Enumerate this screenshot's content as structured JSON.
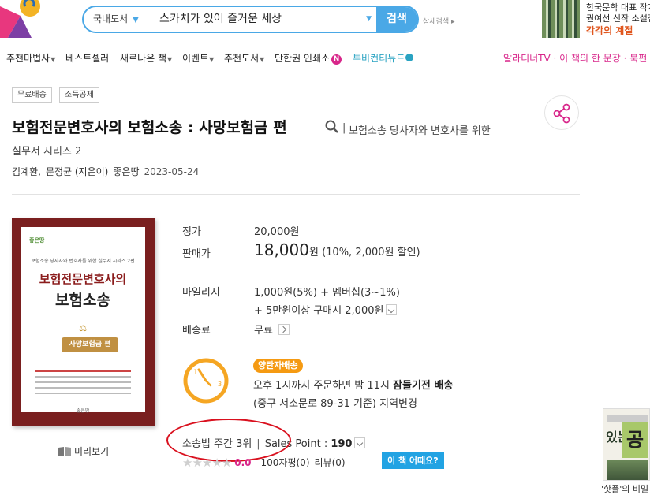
{
  "header": {
    "search_scope": "국내도서",
    "search_query": "스카치가 있어 즐거운 세상",
    "search_button": "검색",
    "advanced_search": "상세검색",
    "banner_line1": "한국문학 대표 작가",
    "banner_line2": "권여선 신작 소설집",
    "banner_line3": "각각의 계절"
  },
  "nav": {
    "items": [
      "추천마법사",
      "베스트셀러",
      "새로나온 책",
      "이벤트",
      "추천도서",
      "단한권 인쇄소",
      "투비컨티뉴드"
    ],
    "badge_n": "N",
    "right": "알라디너TV · 이 책의 한 문장 · 북펀"
  },
  "tags": [
    "무료배송",
    "소득공제"
  ],
  "book": {
    "title": "보험전문변호사의 보험소송 : 사망보험금 편",
    "subtitle_sep": "|",
    "subtitle_part1": "보험소송 당사자와 변호사를 위한",
    "subtitle_part2": "실무서 시리즈 2",
    "author1": "김계환,",
    "author2": "문정균 (지은이)",
    "publisher": "좋은땅",
    "date": "2023-05-24"
  },
  "cover": {
    "logo_text": "좋은땅",
    "series": "보험소송 당사자와 변호사를 위한 실무서 시리즈 2편",
    "title_line1": "보험전문변호사의",
    "title_line2": "보험소송",
    "badge": "사망보험금 편",
    "publisher": "좋은땅"
  },
  "preview_label": "미리보기",
  "price": {
    "list_label": "정가",
    "list_value": "20,000원",
    "sale_label": "판매가",
    "sale_value": "18,000",
    "sale_unit": "원",
    "sale_discount": "(10%, 2,000원 할인)",
    "mileage_label": "마일리지",
    "mileage_line1": "1,000원(5%) + 멤버십(3~1%)",
    "mileage_line2": "+ 5만원이상 구매시 2,000원",
    "shipping_label": "배송료",
    "shipping_value": "무료"
  },
  "delivery": {
    "badge": "양탄자배송",
    "line1_pre": "오후 1시까지 주문하면 밤 11시 ",
    "line1_bold": "잠들기전 배송",
    "line2": "(중구 서소문로 89-31 기준) 지역변경",
    "clock_11": "11",
    "clock_3": "3"
  },
  "sales": {
    "rank": "소송법 주간 3위",
    "sep": "|",
    "point_label": "Sales Point : ",
    "point_value": "190"
  },
  "rating": {
    "stars": "★★★★★",
    "score": "0.0",
    "review_count": "100자평(0)",
    "review_link": "리뷰(0)",
    "how_button": "이 책 어때요?"
  },
  "side_promo": {
    "big1": "있는",
    "big2": "공간",
    "caption": "'핫플'의 비밀"
  },
  "colors": {
    "accent_blue": "#4aa8e6",
    "pink": "#d8268a",
    "cover_red": "#7a1f1f",
    "delivery_orange": "#f59a12",
    "highlight_red": "#d9101e"
  }
}
